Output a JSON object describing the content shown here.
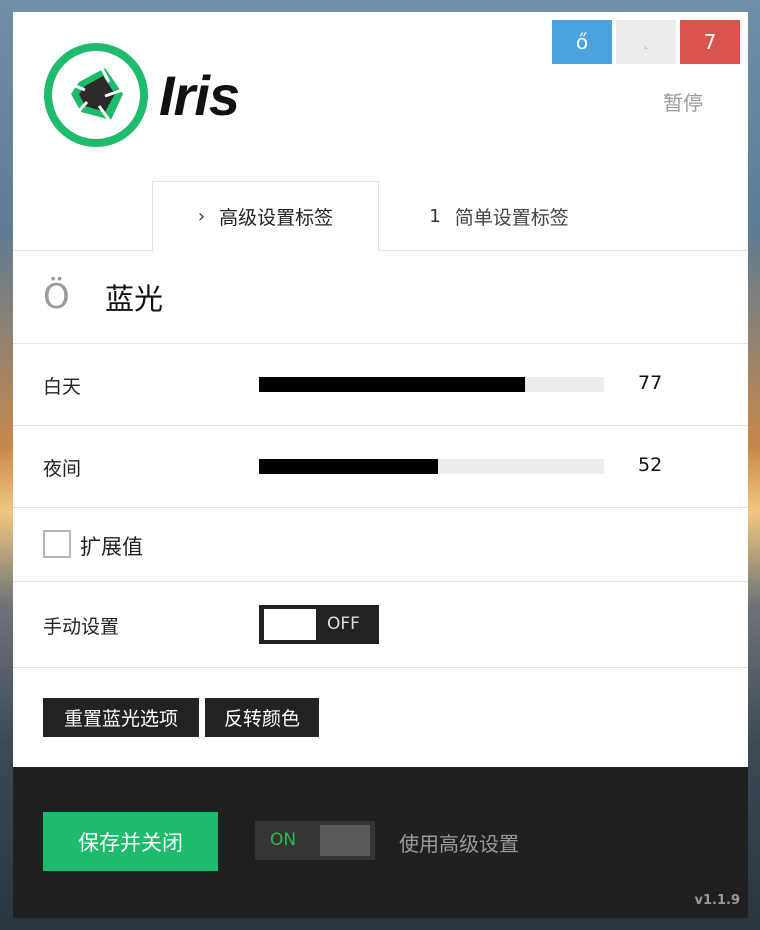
{
  "window_controls": {
    "minimize": "ő",
    "maximize": "˛",
    "close": "7"
  },
  "pause_label": "暂停",
  "logo": {
    "text": "Iris",
    "accent": "#1fbb6c"
  },
  "tabs": [
    {
      "icon": "›",
      "label": "高级设置标签",
      "active": true
    },
    {
      "icon": "1",
      "label": "简单设置标签",
      "active": false
    }
  ],
  "section": {
    "icon_glyph": "Ö",
    "title": "蓝光"
  },
  "sliders": [
    {
      "label": "白天",
      "value": "77",
      "fraction": 0.77
    },
    {
      "label": "夜间",
      "value": "52",
      "fraction": 0.52
    }
  ],
  "extend_values": {
    "label": "扩展值",
    "checked": false
  },
  "manual": {
    "label": "手动设置",
    "toggle_text": "OFF"
  },
  "actions": {
    "reset": "重置蓝光选项",
    "invert": "反转颜色"
  },
  "footer": {
    "save_label": "保存并关闭",
    "toggle_text": "ON",
    "advanced_label": "使用高级设置",
    "version": "v1.1.9"
  },
  "colors": {
    "green": "#1fbb6c",
    "blue": "#4aa3e0",
    "red": "#d9534f",
    "dark": "#202020"
  }
}
